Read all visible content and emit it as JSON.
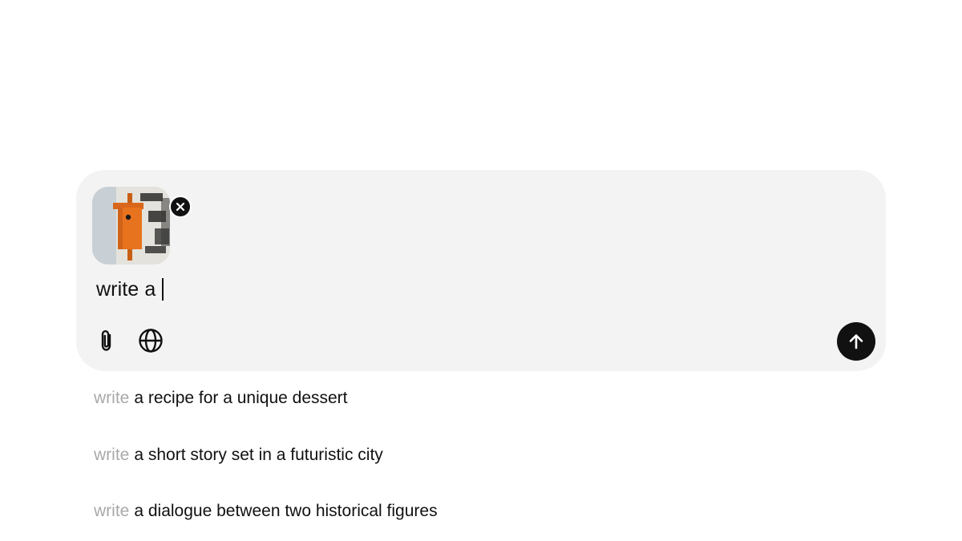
{
  "composer": {
    "attachment": {
      "image_alt": "orange birdhouse on a birch tree trunk",
      "remove_icon": "close-icon"
    },
    "input": {
      "value": "write a"
    },
    "toolbar": {
      "attach_icon": "paperclip-icon",
      "web_icon": "globe-icon",
      "send_icon": "arrow-up-icon"
    }
  },
  "suggestions": [
    {
      "prefix": "write",
      "text": "a recipe for a unique dessert"
    },
    {
      "prefix": "write",
      "text": "a short story set in a futuristic city"
    },
    {
      "prefix": "write",
      "text": "a dialogue between two historical figures"
    }
  ],
  "colors": {
    "composer_bg": "#f3f3f3",
    "primary_text": "#111111",
    "muted_prefix": "#a9a9a9",
    "send_button": "#111111",
    "birdhouse": "#e8731f"
  }
}
